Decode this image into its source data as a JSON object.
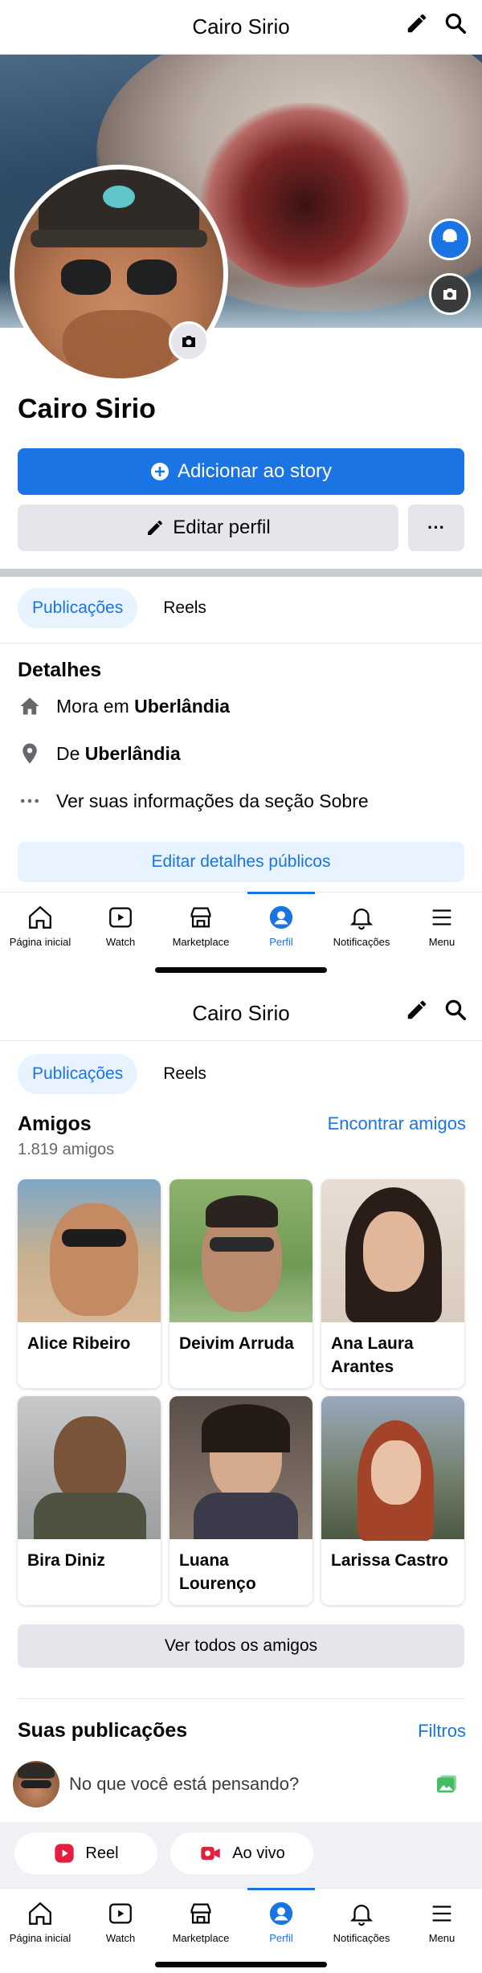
{
  "screen1": {
    "header": {
      "title": "Cairo Sirio",
      "icons": [
        "pencil-icon",
        "search-icon"
      ]
    },
    "profile": {
      "name": "Cairo Sirio"
    },
    "buttons": {
      "add_story": "Adicionar ao story",
      "edit_profile": "Editar perfil",
      "more": "···"
    },
    "tabs": [
      "Publicações",
      "Reels"
    ],
    "details": {
      "title": "Detalhes",
      "lives_prefix": "Mora em ",
      "lives_city": "Uberlândia",
      "from_prefix": "De ",
      "from_city": "Uberlândia",
      "about": "Ver suas informações da seção Sobre",
      "edit_button": "Editar detalhes públicos"
    }
  },
  "tabbar": {
    "items": [
      {
        "label": "Página inicial",
        "icon": "home-icon"
      },
      {
        "label": "Watch",
        "icon": "watch-icon"
      },
      {
        "label": "Marketplace",
        "icon": "marketplace-icon"
      },
      {
        "label": "Perfil",
        "icon": "profile-icon"
      },
      {
        "label": "Notificações",
        "icon": "bell-icon"
      },
      {
        "label": "Menu",
        "icon": "menu-icon"
      }
    ],
    "active": "Perfil"
  },
  "screen2": {
    "header": {
      "title": "Cairo Sirio"
    },
    "tabs": [
      "Publicações",
      "Reels"
    ],
    "friends": {
      "title": "Amigos",
      "count": "1.819 amigos",
      "find": "Encontrar amigos",
      "list": [
        {
          "name": "Alice Ribeiro"
        },
        {
          "name": "Deivim Arruda"
        },
        {
          "name": "Ana Laura Arantes"
        },
        {
          "name": "Bira Diniz"
        },
        {
          "name": "Luana Lourenço"
        },
        {
          "name": "Larissa Castro"
        }
      ],
      "see_all": "Ver todos os amigos"
    },
    "posts": {
      "title": "Suas publicações",
      "filters": "Filtros",
      "composer_placeholder": "No que você está pensando?",
      "reel": "Reel",
      "live": "Ao vivo"
    }
  },
  "colors": {
    "accent": "#1b74e4",
    "light_accent": "#e7f3ff",
    "gray_button": "#e4e6eb",
    "live_red": "#e41e3f",
    "photo_green": "#45bd62"
  }
}
